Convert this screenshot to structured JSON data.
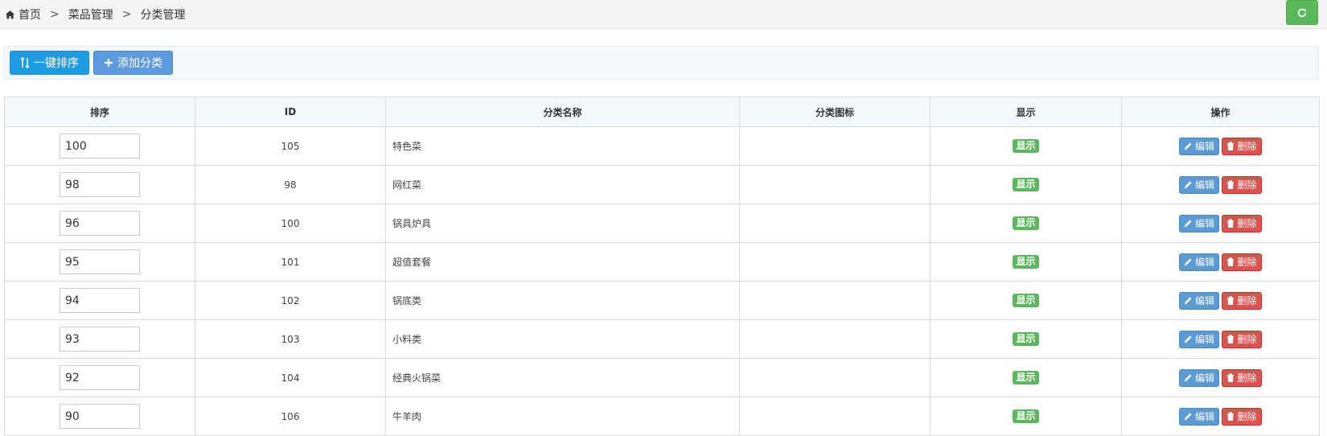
{
  "breadcrumb": {
    "home": "首页",
    "level1": "菜品管理",
    "level2": "分类管理",
    "separator": ">",
    "home_icon": "home-icon"
  },
  "header": {
    "refresh_icon": "refresh-icon"
  },
  "toolbar": {
    "sort_label": "一键排序",
    "sort_icon": "sort-icon",
    "add_label": "添加分类",
    "add_icon": "plus-icon"
  },
  "table": {
    "headers": [
      "排序",
      "ID",
      "分类名称",
      "分类图标",
      "显示",
      "操作"
    ],
    "show_label": "显示",
    "edit_label": "编辑",
    "delete_label": "删除",
    "rows": [
      {
        "sort": "100",
        "id": "105",
        "name": "特色菜"
      },
      {
        "sort": "98",
        "id": "98",
        "name": "网红菜"
      },
      {
        "sort": "96",
        "id": "100",
        "name": "锅具炉具"
      },
      {
        "sort": "95",
        "id": "101",
        "name": "超值套餐"
      },
      {
        "sort": "94",
        "id": "102",
        "name": "锅底类"
      },
      {
        "sort": "93",
        "id": "103",
        "name": "小料类"
      },
      {
        "sort": "92",
        "id": "104",
        "name": "经典火锅菜"
      },
      {
        "sort": "90",
        "id": "106",
        "name": "牛羊肉"
      }
    ]
  },
  "colors": {
    "success": "#5cb85c",
    "primary": "#1e9ce3",
    "info": "#5e9ade",
    "danger": "#d9534f"
  }
}
